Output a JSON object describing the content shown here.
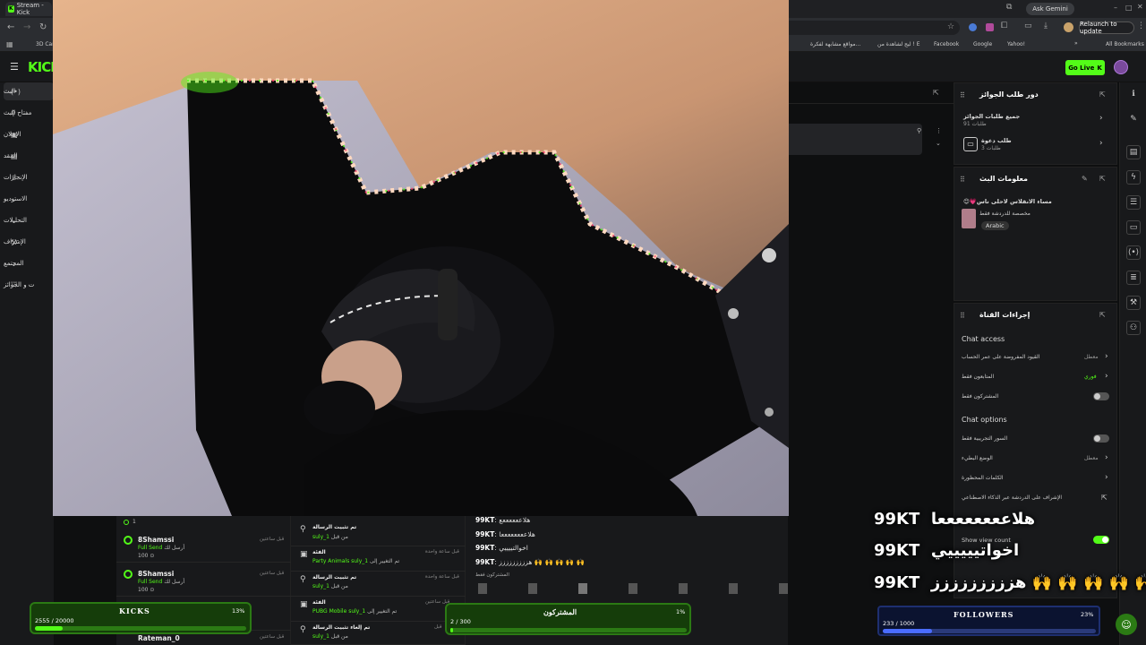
{
  "browser": {
    "tab_title": "Stream - Kick",
    "gemini_label": "Ask Gemini",
    "relaunch_label": "Relaunch to update",
    "bookmarks": [
      "3D Car",
      "مواقع مشابهة لفكرة...",
      "ليج لشاهدة من ! E",
      "Facebook",
      "Google",
      "Yahoo!"
    ],
    "all_bookmarks": "All Bookmarks"
  },
  "kick": {
    "logo": "KICK",
    "go_live": "Go Live"
  },
  "sidebar": {
    "items": [
      {
        "label": "البث",
        "icon": "(•)"
      },
      {
        "label": "مفتاح البث",
        "icon": "⚲"
      },
      {
        "label": "الإعلان",
        "icon": "▣"
      },
      {
        "label": "المقد",
        "icon": "▤"
      },
      {
        "label": "الإنجازات",
        "icon": "♕"
      },
      {
        "label": "الاستوديو",
        "icon": "⌄"
      },
      {
        "label": "التحليلات",
        "icon": "⌄"
      },
      {
        "label": "الإشراف",
        "icon": "⚒"
      },
      {
        "label": "المجتمع",
        "icon": "⌄"
      },
      {
        "label": "ت و الجوائز",
        "icon": "⛫"
      }
    ]
  },
  "rewards_panel": {
    "title": "دور طلب الجوائز",
    "rows": [
      {
        "title": "جميع طلبات الجوائز",
        "sub": "طلبات 91"
      },
      {
        "title": "طلب دعوة",
        "sub": "طلبات 3"
      }
    ]
  },
  "stream_info": {
    "title": "معلومات البث",
    "stream_title": "مساء الانقلاس لاحلى ناس💗😊",
    "category": "مخصصة للدردشة فقط",
    "language": "Arabic"
  },
  "channel_actions": {
    "title": "إجراءات القناة",
    "chat_access_heading": "Chat access",
    "chat_access": [
      {
        "label": "القيود المفروضة على عمر الحساب",
        "value": "معطل"
      },
      {
        "label": "المتابعون فقط",
        "value": "فوري"
      },
      {
        "label": "المشتركون فقط",
        "value": ""
      }
    ],
    "chat_options_heading": "Chat options",
    "chat_options": [
      {
        "label": "السور التجريبية فقط",
        "value": ""
      },
      {
        "label": "الوضع البطيء",
        "value": "معطل"
      },
      {
        "label": "الكلمات المحظورة",
        "value": ""
      },
      {
        "label": "الإشراف على الدردشة عبر الذكاء الاصطناعي",
        "value": ""
      }
    ],
    "show_view_count": "Show view count"
  },
  "left_feed": [
    {
      "name": "8Shamssi",
      "action": "أرسل لك",
      "gift": "Full Send",
      "amount": "100",
      "time": "قبل ساعتين"
    },
    {
      "name": "8Shamssi",
      "action": "أرسل لك",
      "gift": "Full Send",
      "amount": "100",
      "time": "قبل ساعتين"
    },
    {
      "name": "Rateman_0",
      "action": "",
      "gift": "",
      "amount": "",
      "time": "قبل ساعتين"
    }
  ],
  "left_feed_top": {
    "amount": "1"
  },
  "mid_feed": [
    {
      "title": "تم تثبيت الرسالة",
      "sub": "من قبل",
      "user": "suly_1",
      "time": "قبل ساعة واحدة"
    },
    {
      "title": "الفئة",
      "sub": "تم التغيير إلى",
      "extra": "Party Animals",
      "user": "suly_1",
      "time": "قبل ساعة واحدة"
    },
    {
      "title": "تم تثبيت الرسالة",
      "sub": "من قبل",
      "user": "suly_1",
      "time": "قبل ساعتين"
    },
    {
      "title": "الفئة",
      "sub": "تم التغيير إلى",
      "extra": "PUBG Mobile",
      "user": "suly_1",
      "time": "قبل ساعتين"
    },
    {
      "title": "تم إلغاء تثبيت الرسالة",
      "sub": "من قبل",
      "user": "suly_1",
      "time": "قبل"
    }
  ],
  "chat": [
    {
      "user": "99KT",
      "msg": "هلاععععععع"
    },
    {
      "user": "99KT",
      "msg": "هلاععععععععا"
    },
    {
      "user": "99KT",
      "msg": "اخوالتييييي"
    },
    {
      "user": "99KT",
      "msg": "هززززززززز 🙌 🙌 🙌 🙌 🙌"
    }
  ],
  "subscribers_label": "المشتركون فقط",
  "overlay_chat": [
    {
      "user": "99KT",
      "msg": "هلاععععععععا"
    },
    {
      "user": "99KT",
      "msg": "اخواتيييييي"
    },
    {
      "user": "99KT",
      "msg": "هززززززززز 🙌 🙌 🙌 🙌 🙌"
    }
  ],
  "goals": {
    "kicks": {
      "title": "KICKS",
      "current": "2555 / 20000",
      "percent": "13%",
      "fraction": 0.13
    },
    "subs": {
      "title": "المشتركون",
      "current": "2 / 300",
      "percent": "1%",
      "fraction": 0.01
    },
    "followers": {
      "title": "FOLLOWERS",
      "current": "233 / 1000",
      "percent": "23%",
      "fraction": 0.23
    }
  },
  "colors": {
    "accent": "#53fc18",
    "panel": "#18191b",
    "bg": "#0e0f10"
  }
}
